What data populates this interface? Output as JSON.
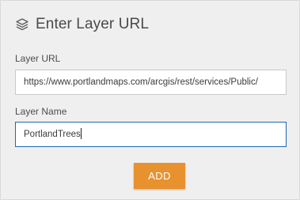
{
  "header": {
    "title": "Enter Layer URL",
    "icon": "layers-icon"
  },
  "layer_url": {
    "label": "Layer URL",
    "value": "https://www.portlandmaps.com/arcgis/rest/services/Public/"
  },
  "layer_name": {
    "label": "Layer Name",
    "value": "PortlandTrees"
  },
  "add_button": {
    "label": "ADD",
    "color": "#e8912f"
  },
  "colors": {
    "panel_background": "#efefef",
    "focus_border": "#1d67b8"
  }
}
